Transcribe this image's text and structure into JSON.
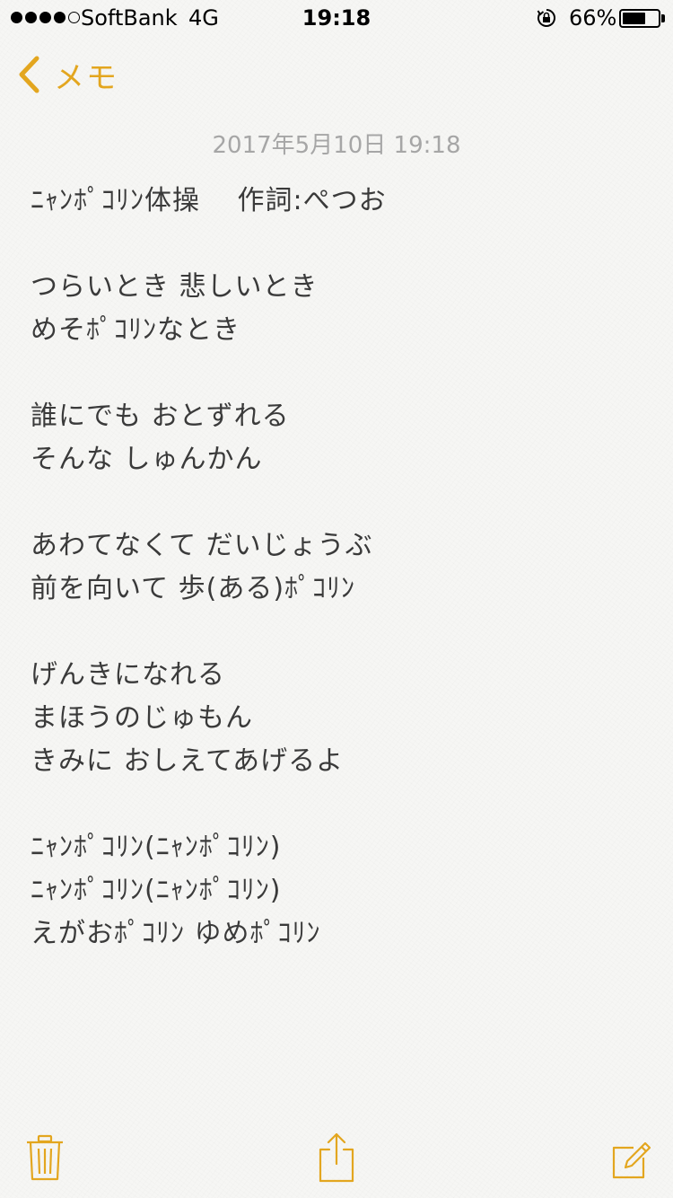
{
  "status_bar": {
    "carrier": "SoftBank",
    "network": "4G",
    "time": "19:18",
    "battery_percent": "66%",
    "battery_level": 0.66,
    "signal_bars_filled": 4,
    "signal_bars_total": 5
  },
  "nav": {
    "back_label": "メモ",
    "accent_color": "#e3a61f"
  },
  "note": {
    "date": "2017年5月10日 19:18",
    "lines": [
      "ﾆｬﾝﾎﾟｺﾘﾝ体操　 作詞:ぺつお",
      "",
      "つらいとき 悲しいとき",
      "めそﾎﾟｺﾘﾝなとき",
      "",
      "誰にでも おとずれる",
      "そんな しゅんかん",
      "",
      "あわてなくて だいじょうぶ",
      "前を向いて 歩(ある)ﾎﾟｺﾘﾝ",
      "",
      "げんきになれる",
      "まほうのじゅもん",
      "きみに おしえてあげるよ",
      "",
      "ﾆｬﾝﾎﾟｺﾘﾝ(ﾆｬﾝﾎﾟｺﾘﾝ)",
      "ﾆｬﾝﾎﾟｺﾘﾝ(ﾆｬﾝﾎﾟｺﾘﾝ)",
      "えがおﾎﾟｺﾘﾝ ゆめﾎﾟｺﾘﾝ"
    ]
  },
  "toolbar": {
    "icons": [
      "trash-icon",
      "share-icon",
      "compose-icon"
    ]
  }
}
